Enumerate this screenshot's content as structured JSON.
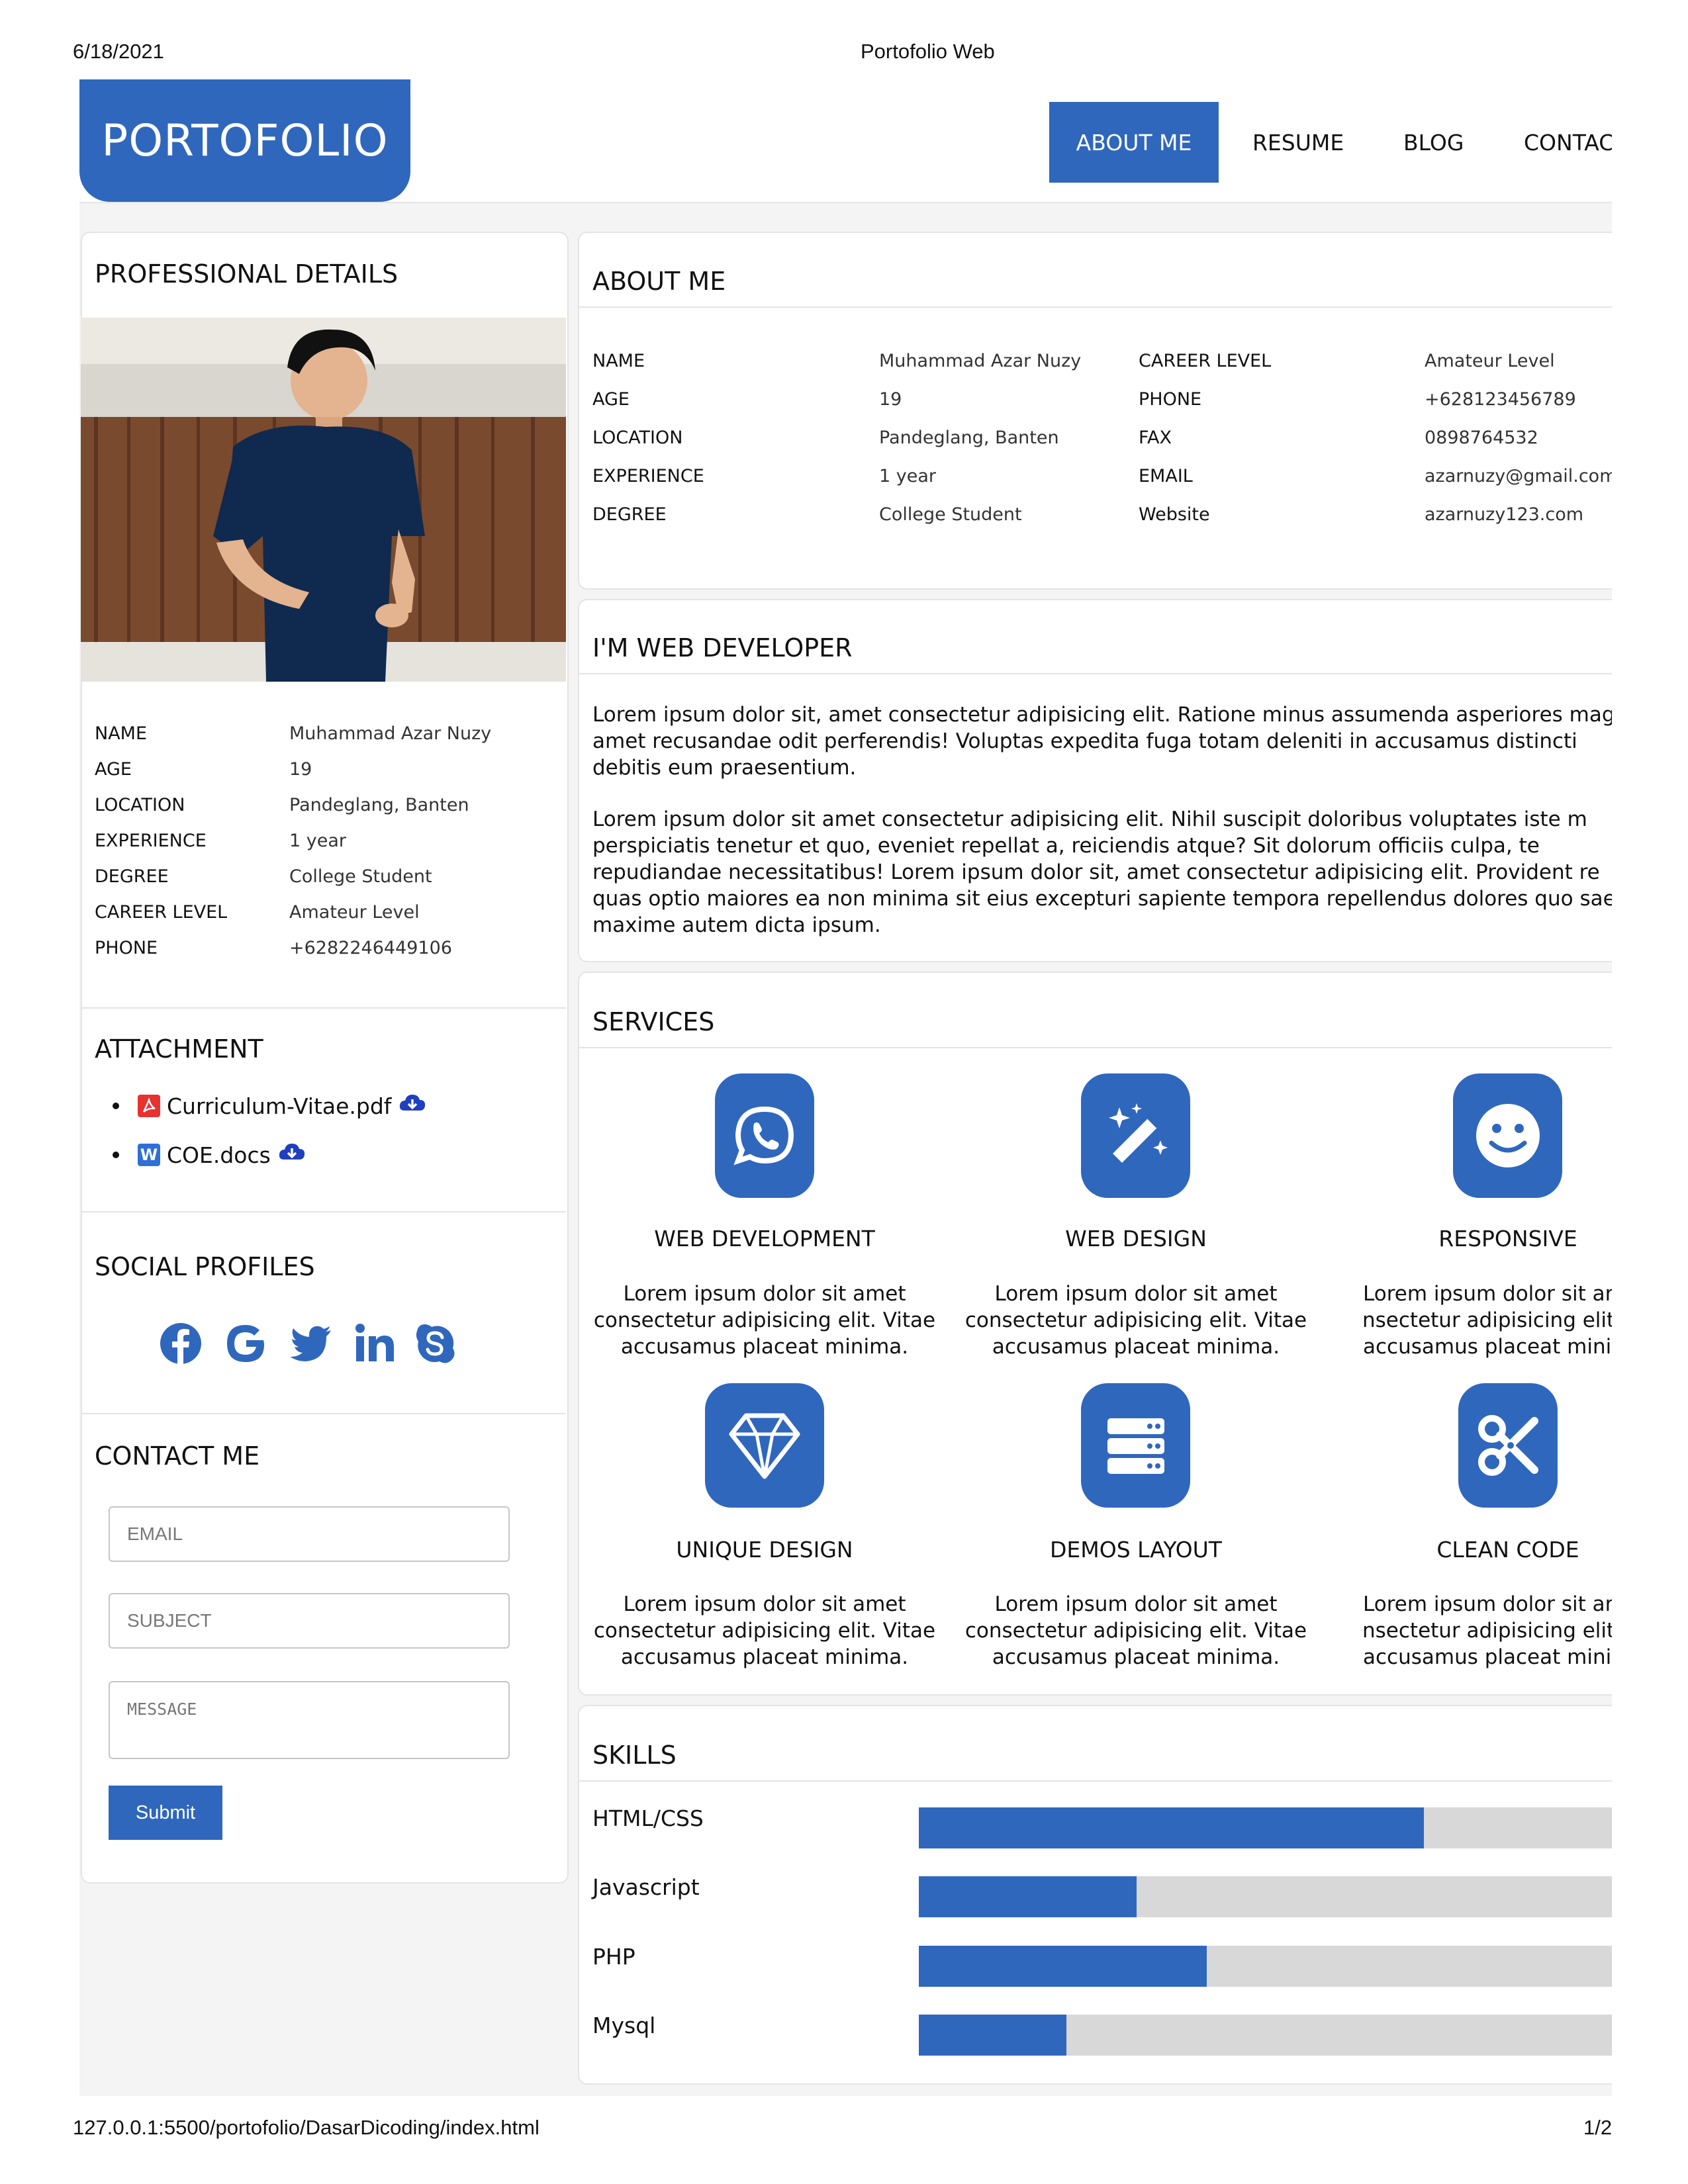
{
  "print": {
    "date": "6/18/2021",
    "title": "Portofolio Web",
    "url": "127.0.0.1:5500/portofolio/DasarDicoding/index.html",
    "page": "1/2"
  },
  "brand": {
    "logo": "PORTOFOLIO",
    "accent": "#2f67bd"
  },
  "nav": {
    "items": [
      "ABOUT ME",
      "RESUME",
      "BLOG",
      "CONTAC"
    ],
    "active": "ABOUT ME"
  },
  "professional": {
    "title": "PROFESSIONAL DETAILS",
    "details": [
      {
        "label": "NAME",
        "value": "Muhammad Azar Nuzy"
      },
      {
        "label": "AGE",
        "value": "19"
      },
      {
        "label": "LOCATION",
        "value": "Pandeglang, Banten"
      },
      {
        "label": "EXPERIENCE",
        "value": "1 year"
      },
      {
        "label": "DEGREE",
        "value": "College Student"
      },
      {
        "label": "CAREER LEVEL",
        "value": "Amateur Level"
      },
      {
        "label": "PHONE",
        "value": "+6282246449106"
      }
    ]
  },
  "attachment": {
    "title": "ATTACHMENT",
    "files": [
      {
        "name": "Curriculum-Vitae.pdf",
        "icon": "pdf-icon"
      },
      {
        "name": "COE.docs",
        "icon": "word-icon",
        "badge": "W"
      }
    ]
  },
  "social": {
    "title": "SOCIAL PROFILES",
    "icons": [
      "facebook-icon",
      "google-icon",
      "twitter-icon",
      "linkedin-icon",
      "skype-icon"
    ]
  },
  "contact": {
    "title": "CONTACT ME",
    "email_placeholder": "EMAIL",
    "subject_placeholder": "SUBJECT",
    "message_placeholder": "MESSAGE",
    "submit": "Submit"
  },
  "about": {
    "title": "ABOUT ME",
    "left": [
      {
        "label": "NAME",
        "value": "Muhammad Azar Nuzy"
      },
      {
        "label": "AGE",
        "value": "19"
      },
      {
        "label": "LOCATION",
        "value": "Pandeglang, Banten"
      },
      {
        "label": "EXPERIENCE",
        "value": "1 year"
      },
      {
        "label": "DEGREE",
        "value": "College Student"
      }
    ],
    "right": [
      {
        "label": "CAREER LEVEL",
        "value": "Amateur Level"
      },
      {
        "label": "PHONE",
        "value": "+628123456789"
      },
      {
        "label": "FAX",
        "value": "0898764532"
      },
      {
        "label": "EMAIL",
        "value": "azarnuzy@gmail.com"
      },
      {
        "label": "Website",
        "value": "azarnuzy123.com"
      }
    ]
  },
  "developer": {
    "title": "I'M WEB DEVELOPER",
    "p1": [
      "Lorem ipsum dolor sit, amet consectetur adipisicing elit. Ratione minus assumenda asperiores magn",
      "amet recusandae odit perferendis! Voluptas expedita fuga totam deleniti in accusamus distincti",
      "debitis eum praesentium."
    ],
    "p2": [
      "Lorem ipsum dolor sit amet consectetur adipisicing elit. Nihil suscipit doloribus voluptates iste m",
      "perspiciatis tenetur et quo, eveniet repellat a, reiciendis atque? Sit dolorum officiis culpa, te",
      "repudiandae necessitatibus! Lorem ipsum dolor sit, amet consectetur adipisicing elit. Provident re",
      "quas optio maiores ea non minima sit eius excepturi sapiente tempora repellendus dolores quo sae",
      "maxime autem dicta ipsum."
    ]
  },
  "services": {
    "title": "SERVICES",
    "items": [
      {
        "title": "WEB DEVELOPMENT",
        "icon": "whatsapp-icon",
        "text": [
          "Lorem ipsum dolor sit amet",
          "consectetur adipisicing elit. Vitae",
          "accusamus placeat minima."
        ]
      },
      {
        "title": "WEB DESIGN",
        "icon": "magic-wand-icon",
        "text": [
          "Lorem ipsum dolor sit amet",
          "consectetur adipisicing elit. Vitae",
          "accusamus placeat minima."
        ]
      },
      {
        "title": "RESPONSIVE",
        "icon": "smile-icon",
        "text": [
          "Lorem ipsum dolor sit ar",
          "consectetur adipisicing elit",
          "accusamus placeat mini"
        ]
      },
      {
        "title": "UNIQUE DESIGN",
        "icon": "diamond-icon",
        "text": [
          "Lorem ipsum dolor sit amet",
          "consectetur adipisicing elit. Vitae",
          "accusamus placeat minima."
        ]
      },
      {
        "title": "DEMOS LAYOUT",
        "icon": "server-icon",
        "text": [
          "Lorem ipsum dolor sit amet",
          "consectetur adipisicing elit. Vitae",
          "accusamus placeat minima."
        ]
      },
      {
        "title": "CLEAN CODE",
        "icon": "scissors-icon",
        "text": [
          "Lorem ipsum dolor sit ar",
          "consectetur adipisicing elit",
          "accusamus placeat mini"
        ]
      }
    ]
  },
  "skills": {
    "title": "SKILLS",
    "items": [
      {
        "name": "HTML/CSS",
        "percent": 72
      },
      {
        "name": "Javascript",
        "percent": 31
      },
      {
        "name": "PHP",
        "percent": 41
      },
      {
        "name": "Mysql",
        "percent": 21
      }
    ]
  }
}
